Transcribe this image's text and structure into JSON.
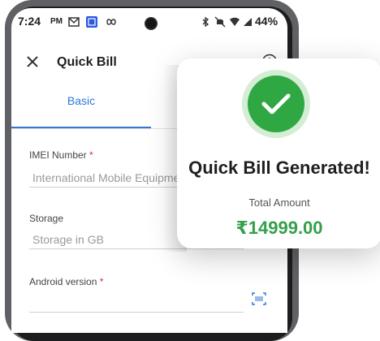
{
  "status_bar": {
    "time": "7:24",
    "carrier": "PM",
    "battery": "44%"
  },
  "app_bar": {
    "title": "Quick Bill"
  },
  "tabs": [
    {
      "label": "Basic"
    }
  ],
  "form": {
    "imei": {
      "label": "IMEI Number",
      "required_mark": "*",
      "placeholder": "International Mobile Equipment"
    },
    "storage": {
      "label": "Storage",
      "placeholder": "Storage in GB"
    },
    "android": {
      "label": "Android version",
      "required_mark": "*",
      "placeholder": ""
    }
  },
  "success_card": {
    "title": "Quick Bill Generated!",
    "subtitle": "Total Amount",
    "amount": "₹14999.00"
  },
  "colors": {
    "accent": "#2f78d4",
    "success": "#2fa844",
    "amount": "#33a04a"
  }
}
